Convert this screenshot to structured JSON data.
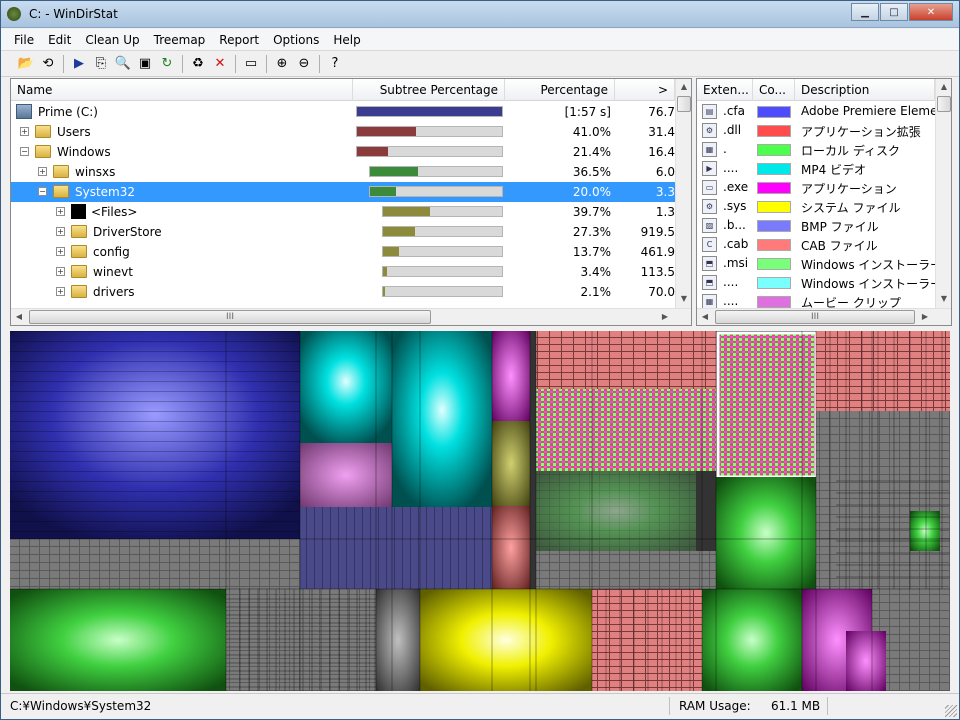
{
  "window": {
    "title": "C: - WinDirStat",
    "min": "▁",
    "max": "□",
    "close": "✕"
  },
  "menu": [
    "File",
    "Edit",
    "Clean Up",
    "Treemap",
    "Report",
    "Options",
    "Help"
  ],
  "toolbar": [
    {
      "id": "open",
      "glyph": "📂"
    },
    {
      "id": "refresh",
      "glyph": "⟲"
    },
    {
      "sep": true
    },
    {
      "id": "play",
      "glyph": "▶"
    },
    {
      "id": "copy",
      "glyph": "⎘"
    },
    {
      "id": "explorer",
      "glyph": "🔍"
    },
    {
      "id": "cmd",
      "glyph": "▣"
    },
    {
      "id": "refresh-sel",
      "glyph": "↻"
    },
    {
      "sep": true
    },
    {
      "id": "recycle",
      "glyph": "♻"
    },
    {
      "id": "delete",
      "glyph": "✕"
    },
    {
      "sep": true
    },
    {
      "id": "properties",
      "glyph": "▭"
    },
    {
      "sep": true
    },
    {
      "id": "zoom-in",
      "glyph": "⊕"
    },
    {
      "id": "zoom-out",
      "glyph": "⊖"
    },
    {
      "sep": true
    },
    {
      "id": "help",
      "glyph": "?"
    }
  ],
  "tree": {
    "columns": [
      "Name",
      "Subtree Percentage",
      "Percentage",
      ">"
    ],
    "rows": [
      {
        "name": "Prime (C:)",
        "level": 0,
        "icon": "drive",
        "expander": "",
        "fill": 1.0,
        "color": "#3b3b8f",
        "pct": "[1:57 s]",
        "size": "76.7",
        "selected": false
      },
      {
        "name": "Users",
        "level": 0,
        "icon": "folder",
        "expander": "+",
        "fill": 0.41,
        "color": "#8b3b3b",
        "pct": "41.0%",
        "size": "31.4",
        "selected": false
      },
      {
        "name": "Windows",
        "level": 0,
        "icon": "folder",
        "expander": "−",
        "fill": 0.214,
        "color": "#8b3b3b",
        "pct": "21.4%",
        "size": "16.4",
        "selected": false
      },
      {
        "name": "winsxs",
        "level": 1,
        "icon": "folder",
        "expander": "+",
        "fill": 0.365,
        "color": "#3b8b3b",
        "pct": "36.5%",
        "size": "6.0",
        "selected": false
      },
      {
        "name": "System32",
        "level": 1,
        "icon": "folder",
        "expander": "−",
        "fill": 0.2,
        "color": "#3b8b3b",
        "pct": "20.0%",
        "size": "3.3",
        "selected": true
      },
      {
        "name": "<Files>",
        "level": 2,
        "icon": "files",
        "expander": "+",
        "fill": 0.397,
        "color": "#8b8b3b",
        "pct": "39.7%",
        "size": "1.3",
        "selected": false
      },
      {
        "name": "DriverStore",
        "level": 2,
        "icon": "folder",
        "expander": "+",
        "fill": 0.273,
        "color": "#8b8b3b",
        "pct": "27.3%",
        "size": "919.5",
        "selected": false
      },
      {
        "name": "config",
        "level": 2,
        "icon": "folder",
        "expander": "+",
        "fill": 0.137,
        "color": "#8b8b3b",
        "pct": "13.7%",
        "size": "461.9",
        "selected": false
      },
      {
        "name": "winevt",
        "level": 2,
        "icon": "folder",
        "expander": "+",
        "fill": 0.034,
        "color": "#8b8b3b",
        "pct": "3.4%",
        "size": "113.5",
        "selected": false
      },
      {
        "name": "drivers",
        "level": 2,
        "icon": "folder",
        "expander": "+",
        "fill": 0.021,
        "color": "#8b8b3b",
        "pct": "2.1%",
        "size": "70.0",
        "selected": false
      }
    ]
  },
  "extensions": {
    "columns": [
      "Exten...",
      "Co...",
      "Description"
    ],
    "rows": [
      {
        "ext": ".cfa",
        "color": "#4d4dff",
        "desc": "Adobe Premiere Eleme",
        "icon": "▤"
      },
      {
        "ext": ".dll",
        "color": "#ff4d4d",
        "desc": "アプリケーション拡張",
        "icon": "⚙"
      },
      {
        "ext": ".",
        "color": "#4dff4d",
        "desc": "ローカル ディスク",
        "icon": "▦"
      },
      {
        "ext": "....",
        "color": "#00e8e8",
        "desc": "MP4 ビデオ",
        "icon": "▶"
      },
      {
        "ext": ".exe",
        "color": "#ff00ff",
        "desc": "アプリケーション",
        "icon": "▭"
      },
      {
        "ext": ".sys",
        "color": "#ffff00",
        "desc": "システム ファイル",
        "icon": "⚙"
      },
      {
        "ext": ".b...",
        "color": "#7a7aff",
        "desc": "BMP ファイル",
        "icon": "▨"
      },
      {
        "ext": ".cab",
        "color": "#ff7a7a",
        "desc": "CAB ファイル",
        "icon": "C"
      },
      {
        "ext": ".msi",
        "color": "#7aff7a",
        "desc": "Windows インストーラー",
        "icon": "⬒"
      },
      {
        "ext": "....",
        "color": "#7affff",
        "desc": "Windows インストーラー",
        "icon": "⬒"
      },
      {
        "ext": "....",
        "color": "#e070e0",
        "desc": "ムービー クリップ",
        "icon": "▦"
      }
    ]
  },
  "status": {
    "path": "C:¥Windows¥System32",
    "ram_label": "RAM Usage:",
    "ram_value": "61.1 MB"
  }
}
